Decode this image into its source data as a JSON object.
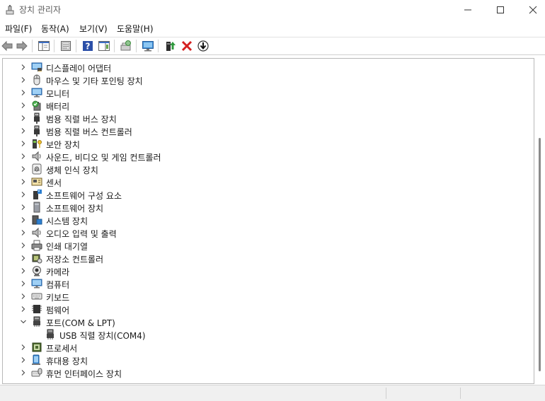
{
  "window": {
    "title": "장치 관리자",
    "controls": {
      "minimize": "─",
      "maximize": "☐",
      "close": "✕"
    }
  },
  "menu": [
    {
      "id": "file",
      "label": "파일(F)"
    },
    {
      "id": "action",
      "label": "동작(A)"
    },
    {
      "id": "view",
      "label": "보기(V)"
    },
    {
      "id": "help",
      "label": "도움말(H)"
    }
  ],
  "toolbar": [
    {
      "name": "back-icon"
    },
    {
      "name": "forward-icon"
    },
    {
      "name": "show-hide-console-tree-icon"
    },
    {
      "name": "properties-icon"
    },
    {
      "name": "help-icon"
    },
    {
      "name": "action-pane-icon"
    },
    {
      "name": "scan-hardware-changes-icon"
    },
    {
      "name": "monitor-icon"
    },
    {
      "name": "update-driver-icon"
    },
    {
      "name": "uninstall-device-icon",
      "color": "#d42020"
    },
    {
      "name": "disable-device-icon"
    }
  ],
  "tree": {
    "items": [
      {
        "label": "디스플레이 어댑터",
        "icon": "display-adapter-icon",
        "expanded": false
      },
      {
        "label": "마우스 및 기타 포인팅 장치",
        "icon": "mouse-icon",
        "expanded": false
      },
      {
        "label": "모니터",
        "icon": "monitor-icon",
        "expanded": false
      },
      {
        "label": "배터리",
        "icon": "battery-icon",
        "expanded": false
      },
      {
        "label": "범용 직렬 버스 장치",
        "icon": "usb-icon",
        "expanded": false
      },
      {
        "label": "범용 직렬 버스 컨트롤러",
        "icon": "usb-icon",
        "expanded": false
      },
      {
        "label": "보안 장치",
        "icon": "security-key-icon",
        "expanded": false
      },
      {
        "label": "사운드, 비디오 및 게임 컨트롤러",
        "icon": "speaker-icon",
        "expanded": false
      },
      {
        "label": "생체 인식 장치",
        "icon": "fingerprint-icon",
        "expanded": false
      },
      {
        "label": "센서",
        "icon": "sensor-icon",
        "expanded": false
      },
      {
        "label": "소프트웨어 구성 요소",
        "icon": "software-component-icon",
        "expanded": false
      },
      {
        "label": "소프트웨어 장치",
        "icon": "software-device-icon",
        "expanded": false
      },
      {
        "label": "시스템 장치",
        "icon": "system-device-icon",
        "expanded": false
      },
      {
        "label": "오디오 입력 및 출력",
        "icon": "speaker-icon",
        "expanded": false
      },
      {
        "label": "인쇄 대기열",
        "icon": "printer-icon",
        "expanded": false
      },
      {
        "label": "저장소 컨트롤러",
        "icon": "storage-controller-icon",
        "expanded": false
      },
      {
        "label": "카메라",
        "icon": "camera-icon",
        "expanded": false
      },
      {
        "label": "컴퓨터",
        "icon": "computer-icon",
        "expanded": false
      },
      {
        "label": "키보드",
        "icon": "keyboard-icon",
        "expanded": false
      },
      {
        "label": "펌웨어",
        "icon": "firmware-icon",
        "expanded": false
      },
      {
        "label": "포트(COM & LPT)",
        "icon": "port-icon",
        "expanded": true
      },
      {
        "label": "USB 직렬 장치(COM4)",
        "icon": "port-icon",
        "child": true
      },
      {
        "label": "프로세서",
        "icon": "processor-icon",
        "expanded": false
      },
      {
        "label": "휴대용 장치",
        "icon": "portable-device-icon",
        "expanded": false
      },
      {
        "label": "휴먼 인터페이스 장치",
        "icon": "hid-icon",
        "expanded": false
      }
    ]
  }
}
